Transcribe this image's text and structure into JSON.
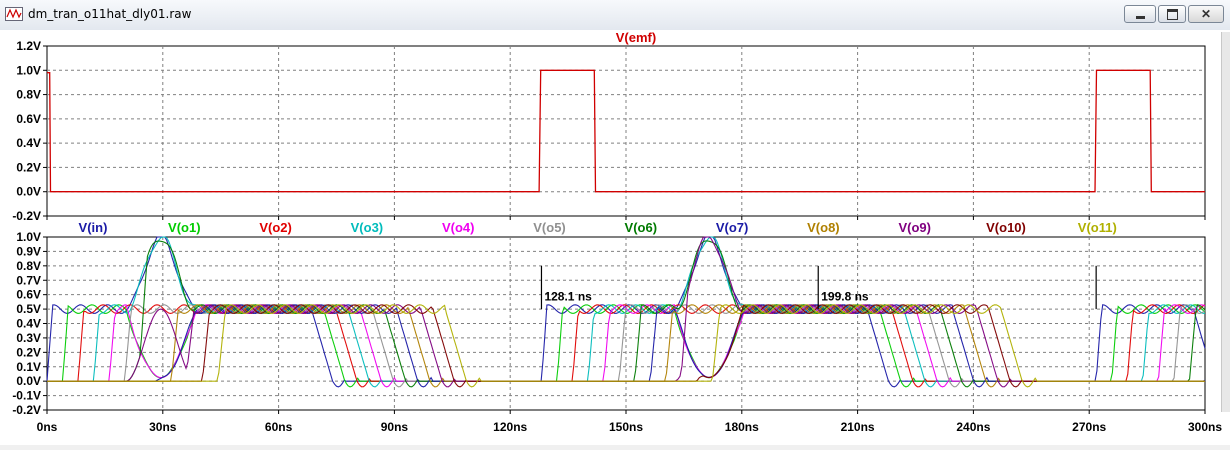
{
  "window": {
    "title": "dm_tran_o11hat_dly01.raw",
    "icon": "ltspice-waveform-icon",
    "buttons": [
      "minimize-icon",
      "maximize-icon",
      "close-icon"
    ]
  },
  "colors": {
    "V(emf)": "#d00000",
    "V(in)": "#1a1aa6",
    "V(o1)": "#00cc00",
    "V(o2)": "#e00000",
    "V(o3)": "#00bcbc",
    "V(o4)": "#f000f0",
    "V(o5)": "#909090",
    "V(o6)": "#007a00",
    "V(o7)": "#1a1aa6",
    "V(o8)": "#b08000",
    "V(o9)": "#800080",
    "V(o10)": "#800000",
    "V(o11)": "#b0b000"
  },
  "chart_data": [
    {
      "type": "line",
      "x_ticks": [
        "0ns",
        "30ns",
        "60ns",
        "90ns",
        "120ns",
        "150ns",
        "180ns",
        "210ns",
        "240ns",
        "270ns",
        "300ns"
      ],
      "y_ticks": [
        "1.2V",
        "1.0V",
        "0.8V",
        "0.6V",
        "0.4V",
        "0.2V",
        "0.0V",
        "-0.2V"
      ],
      "xlim": [
        0,
        300
      ],
      "ylim": [
        -0.2,
        1.2
      ],
      "grid": true,
      "series": [
        {
          "name": "V(emf)",
          "points": [
            [
              0,
              0.98
            ],
            [
              0.7,
              0.98
            ],
            [
              0.9,
              0
            ],
            [
              127.5,
              0
            ],
            [
              127.9,
              1.0
            ],
            [
              141.8,
              1.0
            ],
            [
              142.1,
              0
            ],
            [
              271.5,
              0
            ],
            [
              271.9,
              1.0
            ],
            [
              285.8,
              1.0
            ],
            [
              286.1,
              0
            ],
            [
              300,
              0
            ]
          ]
        }
      ]
    },
    {
      "type": "line",
      "x_ticks": [
        "0ns",
        "30ns",
        "60ns",
        "90ns",
        "120ns",
        "150ns",
        "180ns",
        "210ns",
        "240ns",
        "270ns",
        "300ns"
      ],
      "y_ticks": [
        "1.0V",
        "0.9V",
        "0.8V",
        "0.7V",
        "0.6V",
        "0.5V",
        "0.4V",
        "0.3V",
        "0.2V",
        "0.1V",
        "0.0V",
        "-0.1V",
        "-0.2V"
      ],
      "xlim": [
        0,
        300
      ],
      "ylim": [
        -0.2,
        1.0
      ],
      "grid": true,
      "legend": [
        "V(in)",
        "V(o1)",
        "V(o2)",
        "V(o3)",
        "V(o4)",
        "V(o5)",
        "V(o6)",
        "V(o7)",
        "V(o8)",
        "V(o9)",
        "V(o10)",
        "V(o11)"
      ],
      "pulse_high": 0.5,
      "bursts": [
        {
          "start": 0,
          "in_end": 71.5,
          "stage_delay": 3.5,
          "swing_center": 29.5,
          "swing_peak": 1.0
        },
        {
          "start": 128.1,
          "in_end": 215.5,
          "stage_delay": 3.5,
          "swing_center": 171.5,
          "swing_peak": 1.0
        },
        {
          "start": 271.8,
          "in_end": 300,
          "stage_delay": 3.5,
          "swing_center": null,
          "swing_peak": null
        }
      ],
      "annotations": [
        {
          "text": "128.1 ns",
          "x": 128.1,
          "y": 0.58
        },
        {
          "text": "199.8 ns",
          "x": 199.8,
          "y": 0.58
        }
      ],
      "cursors": [
        128.1,
        199.8,
        271.8
      ]
    }
  ]
}
